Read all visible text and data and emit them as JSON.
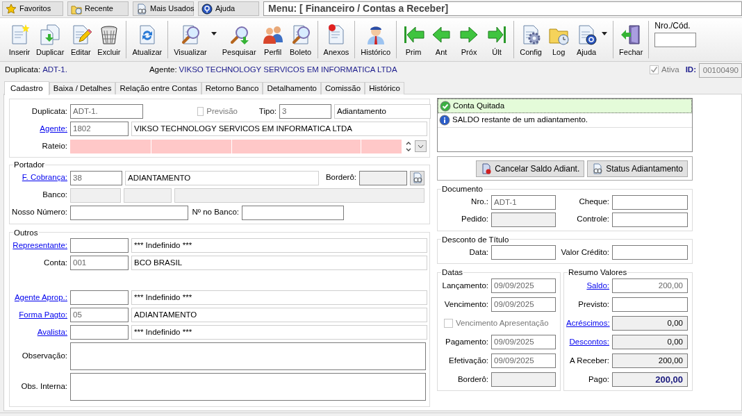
{
  "top_bar": {
    "buttons": [
      {
        "label": "Favoritos"
      },
      {
        "label": "Recente"
      },
      {
        "label": "Mais Usados"
      },
      {
        "label": "Ajuda"
      }
    ],
    "menu_title": "Menu: [ Financeiro / Contas a Receber]"
  },
  "toolbar": {
    "groups": [
      {
        "items": [
          {
            "label": "Inserir",
            "dropdown": false
          },
          {
            "label": "Duplicar",
            "dropdown": false
          },
          {
            "label": "Editar",
            "dropdown": false
          },
          {
            "label": "Excluir",
            "dropdown": false
          }
        ]
      },
      {
        "items": [
          {
            "label": "Atualizar",
            "dropdown": false
          }
        ]
      },
      {
        "items": [
          {
            "label": "Visualizar",
            "dropdown": true
          },
          {
            "label": "Pesquisar",
            "dropdown": false
          },
          {
            "label": "Perfil",
            "dropdown": false
          },
          {
            "label": "Boleto",
            "dropdown": false
          }
        ]
      },
      {
        "items": [
          {
            "label": "Anexos",
            "dropdown": false
          }
        ]
      },
      {
        "items": [
          {
            "label": "Histórico",
            "dropdown": false
          }
        ]
      },
      {
        "items": [
          {
            "label": "Prim",
            "dropdown": false
          },
          {
            "label": "Ant",
            "dropdown": false
          },
          {
            "label": "Próx",
            "dropdown": false
          },
          {
            "label": "Últ",
            "dropdown": false
          }
        ]
      },
      {
        "items": [
          {
            "label": "Config",
            "dropdown": false
          },
          {
            "label": "Log",
            "dropdown": false
          },
          {
            "label": "Ajuda",
            "dropdown": true
          }
        ]
      },
      {
        "items": [
          {
            "label": "Fechar",
            "dropdown": false
          }
        ]
      }
    ],
    "search_label": "Nro./Cód."
  },
  "header": {
    "duplicata_label": "Duplicata:",
    "duplicata": "ADT-1.",
    "agente_label": "Agente:",
    "agente": "VIKSO TECHNOLOGY SERVICOS EM INFORMATICA LTDA",
    "ativa": {
      "label": "Ativa",
      "checked": true,
      "disabled": true
    },
    "id_label": "ID:",
    "id": "00100490"
  },
  "tabs": [
    {
      "label": "Cadastro",
      "selected": true
    },
    {
      "label": "Baixa / Detalhes",
      "selected": false
    },
    {
      "label": "Relação entre Contas",
      "selected": false
    },
    {
      "label": "Retorno Banco",
      "selected": false
    },
    {
      "label": "Detalhamento",
      "selected": false
    },
    {
      "label": "Comissão",
      "selected": false
    },
    {
      "label": "Histórico",
      "selected": false
    }
  ],
  "left_sections": [
    {
      "rows": [
        {
          "items": [
            {
              "kind": "label",
              "text": "Duplicata:",
              "link": false
            },
            {
              "kind": "code",
              "value": "ADT-1."
            },
            {
              "kind": "checkbox",
              "label": "Previsão",
              "checked": false,
              "disabled": true
            },
            {
              "kind": "label",
              "text": "Tipo:",
              "link": false
            },
            {
              "kind": "code",
              "value": "3"
            },
            {
              "kind": "text",
              "value": "Adiantamento"
            }
          ]
        },
        {
          "items": [
            {
              "kind": "label",
              "text": "Agente:",
              "link": true
            },
            {
              "kind": "code",
              "value": "1802"
            },
            {
              "kind": "text",
              "value": "VIKSO TECHNOLOGY SERVICOS EM INFORMATICA LTDA"
            }
          ]
        },
        {
          "items": [
            {
              "kind": "label",
              "text": "Rateio:",
              "link": false
            },
            {
              "kind": "grid"
            },
            {
              "kind": "spinner"
            },
            {
              "kind": "dropdown"
            }
          ]
        }
      ]
    },
    {
      "legend": "Portador",
      "rows": [
        {
          "items": [
            {
              "kind": "label",
              "text": "F. Cobrança:",
              "link": true
            },
            {
              "kind": "code",
              "value": "38"
            },
            {
              "kind": "text",
              "value": "ADIANTAMENTO"
            },
            {
              "kind": "label",
              "text": "Borderô:",
              "link": false
            },
            {
              "kind": "locked"
            },
            {
              "kind": "icon_button"
            }
          ]
        },
        {
          "items": [
            {
              "kind": "label",
              "text": "Banco:",
              "link": false
            },
            {
              "kind": "locked_light"
            },
            {
              "kind": "locked_light"
            },
            {
              "kind": "locked_light"
            }
          ]
        },
        {
          "items": [
            {
              "kind": "label",
              "text": "Nosso Número:",
              "link": false
            },
            {
              "kind": "input"
            },
            {
              "kind": "label",
              "text": "Nº no Banco:",
              "link": false
            },
            {
              "kind": "input"
            }
          ]
        }
      ]
    },
    {
      "legend": "Outros",
      "rows": [
        {
          "items": [
            {
              "kind": "label",
              "text": "Representante:",
              "link": true
            },
            {
              "kind": "input"
            },
            {
              "kind": "text",
              "value": "*** Indefinido ***"
            }
          ]
        },
        {
          "items": [
            {
              "kind": "label",
              "text": "Conta:",
              "link": false
            },
            {
              "kind": "code",
              "value": "001"
            },
            {
              "kind": "text",
              "value": "BCO BRASIL"
            }
          ]
        },
        {
          "items": []
        },
        {
          "items": [
            {
              "kind": "label",
              "text": "Agente Aprop.:",
              "link": true
            },
            {
              "kind": "input"
            },
            {
              "kind": "text",
              "value": "*** Indefinido ***"
            }
          ]
        },
        {
          "items": [
            {
              "kind": "label",
              "text": "Forma Pagto:",
              "link": true
            },
            {
              "kind": "code",
              "value": "05"
            },
            {
              "kind": "text",
              "value": "ADIANTAMENTO"
            }
          ]
        },
        {
          "items": [
            {
              "kind": "label",
              "text": "Avalista:",
              "link": true
            },
            {
              "kind": "input"
            },
            {
              "kind": "text",
              "value": "*** Indefinido ***"
            }
          ]
        },
        {
          "items": [
            {
              "kind": "label",
              "text": "Observação:",
              "link": false
            },
            {
              "kind": "memo"
            }
          ]
        },
        {
          "items": [
            {
              "kind": "label",
              "text": "Obs. Interna:",
              "link": false
            },
            {
              "kind": "memo"
            }
          ]
        }
      ]
    }
  ],
  "messages": [
    {
      "kind": "success",
      "text": "Conta Quitada",
      "selected": true
    },
    {
      "kind": "info",
      "text": "SALDO restante de um adiantamento.",
      "selected": false
    }
  ],
  "action_buttons": [
    {
      "label": "Cancelar Saldo Adiant."
    },
    {
      "label": "Status Adiantamento"
    }
  ],
  "right_sections": [
    {
      "legend": "Documento",
      "rows": [
        {
          "items": [
            {
              "kind": "label",
              "text": "Nro.:",
              "link": false
            },
            {
              "kind": "code",
              "value": "ADT-1"
            },
            {
              "kind": "label",
              "text": "Cheque:",
              "link": false
            },
            {
              "kind": "input"
            }
          ]
        },
        {
          "items": [
            {
              "kind": "label",
              "text": "Pedido:",
              "link": false
            },
            {
              "kind": "locked"
            },
            {
              "kind": "label",
              "text": "Controle:",
              "link": false
            },
            {
              "kind": "input"
            }
          ]
        }
      ]
    },
    {
      "legend": "Desconto de Título",
      "rows": [
        {
          "items": [
            {
              "kind": "label",
              "text": "Data:",
              "link": false
            },
            {
              "kind": "input"
            },
            {
              "kind": "label",
              "text": "Valor Crédito:",
              "link": false
            },
            {
              "kind": "input"
            }
          ]
        }
      ]
    },
    {
      "legend": "Datas",
      "rows": [
        {
          "items": [
            {
              "kind": "label",
              "text": "Lançamento:",
              "link": false
            },
            {
              "kind": "code",
              "value": "09/09/2025"
            }
          ]
        },
        {
          "items": [
            {
              "kind": "label",
              "text": "Vencimento:",
              "link": false
            },
            {
              "kind": "code",
              "value": "09/09/2025"
            }
          ]
        },
        {
          "items": [
            {
              "kind": "checkbox",
              "label": "Vencimento Apresentação",
              "checked": false,
              "disabled": true
            }
          ]
        },
        {
          "items": [
            {
              "kind": "label",
              "text": "Pagamento:",
              "link": false
            },
            {
              "kind": "code",
              "value": "09/09/2025"
            }
          ]
        },
        {
          "items": [
            {
              "kind": "label",
              "text": "Efetivação:",
              "link": false
            },
            {
              "kind": "code",
              "value": "09/09/2025"
            }
          ]
        },
        {
          "items": [
            {
              "kind": "label",
              "text": "Borderô:",
              "link": false
            },
            {
              "kind": "locked"
            }
          ]
        }
      ]
    },
    {
      "legend": "Resumo Valores",
      "rows": [
        {
          "items": [
            {
              "kind": "label",
              "text": "Saldo:",
              "link": true
            },
            {
              "kind": "amount",
              "value": "200,00"
            }
          ]
        },
        {
          "items": [
            {
              "kind": "label",
              "text": "Previsto:",
              "link": false
            },
            {
              "kind": "input"
            }
          ]
        },
        {
          "items": [
            {
              "kind": "label",
              "text": "Acréscimos:",
              "link": true
            },
            {
              "kind": "amount_locked",
              "value": "0,00"
            }
          ]
        },
        {
          "items": [
            {
              "kind": "label",
              "text": "Descontos:",
              "link": true
            },
            {
              "kind": "amount_locked",
              "value": "0,00"
            }
          ]
        },
        {
          "items": [
            {
              "kind": "label",
              "text": "A Receber:",
              "link": false
            },
            {
              "kind": "amount_locked",
              "value": "200,00"
            }
          ]
        },
        {
          "items": [
            {
              "kind": "label",
              "text": "Pago:",
              "link": false
            },
            {
              "kind": "total",
              "value": "200,00"
            }
          ]
        }
      ]
    }
  ]
}
